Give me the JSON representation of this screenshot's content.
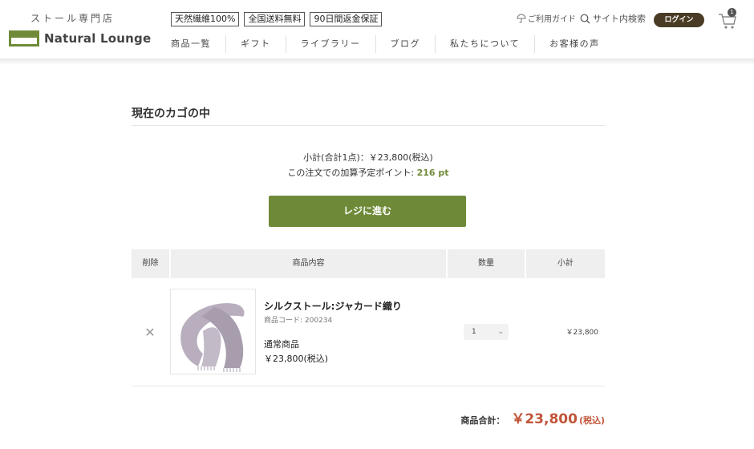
{
  "header": {
    "tagline": "ストール専門店",
    "logo_text": "Natural Lounge",
    "badges": [
      "天然繊維100%",
      "全国送料無料",
      "90日間返金保証"
    ],
    "nav": [
      "商品一覧",
      "ギフト",
      "ライブラリー",
      "ブログ",
      "私たちについて",
      "お客様の声"
    ],
    "guide_label": "ご利用ガイド",
    "search_label": "サイト内検索",
    "login_label": "ログイン",
    "cart_count": "1"
  },
  "cart": {
    "title": "現在のカゴの中",
    "subtotal_line": "小計(合計1点)：￥23,800(税込)",
    "points_prefix": "この注文での加算予定ポイント: ",
    "points_value": "216 pt",
    "checkout_label": "レジに進む",
    "columns": [
      "削除",
      "商品内容",
      "数量",
      "小計"
    ],
    "item": {
      "name": "シルクストール:ジャカード織り",
      "code": "商品コード: 200234",
      "type": "通常商品",
      "price": "￥23,800(税込)",
      "quantity": "1",
      "subtotal": "￥23,800"
    },
    "total_label": "商品合計：",
    "total_value": "￥23,800",
    "total_tax": "(税込)"
  },
  "icons": {
    "remove": "close-icon",
    "search": "search-icon",
    "guide": "umbrella-icon",
    "cart": "cart-icon",
    "chevron": "chevron-down-icon"
  },
  "colors": {
    "accent_green": "#6e8a38",
    "login_brown": "#4a3b24",
    "price_red": "#c1553a"
  }
}
